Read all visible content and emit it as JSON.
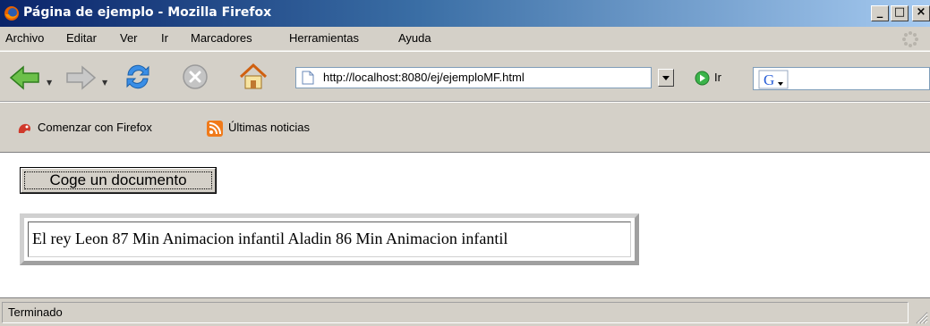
{
  "window": {
    "title": "Página de ejemplo - Mozilla Firefox",
    "minimize": "_",
    "maximize": "□",
    "close": "×"
  },
  "menu": {
    "items": [
      "Archivo",
      "Editar",
      "Ver",
      "Ir",
      "Marcadores",
      "Herramientas",
      "Ayuda"
    ]
  },
  "navigation": {
    "url": "http://localhost:8080/ej/ejemploMF.html",
    "go_label": "Ir"
  },
  "bookmarks": {
    "items": [
      "Comenzar con Firefox",
      "Últimas noticias"
    ]
  },
  "page": {
    "button_label": "Coge un documento",
    "result_text": "El rey Leon 87 Min Animacion infantil Aladin 86 Min Animacion infantil"
  },
  "status": {
    "text": "Terminado"
  },
  "colors": {
    "titlebar_start": "#0a246a",
    "titlebar_end": "#a6caf0",
    "chrome": "#d4d0c8"
  },
  "icons": {
    "back": "back-arrow-icon",
    "forward": "forward-arrow-icon",
    "reload": "reload-icon",
    "stop": "stop-icon",
    "home": "home-icon",
    "go": "go-icon",
    "search_engine": "google-icon"
  }
}
